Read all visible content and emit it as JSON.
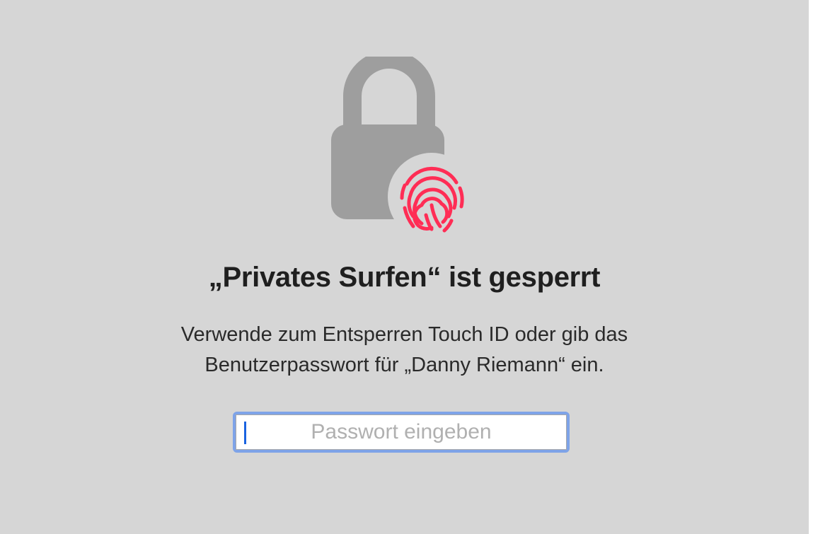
{
  "lock_screen": {
    "title": "„Privates Surfen“ ist gesperrt",
    "description_line1": "Verwende zum Entsperren Touch ID oder gib das",
    "description_line2": "Benutzerpasswort für „Danny Riemann“ ein.",
    "password_field": {
      "value": "",
      "placeholder": "Passwort eingeben"
    },
    "icons": [
      "lock-icon",
      "fingerprint-icon"
    ],
    "colors": {
      "background": "#d6d6d6",
      "lock_gray": "#9e9e9e",
      "fingerprint_red": "#ff2d55",
      "focus_ring": "#7ea3e8",
      "caret": "#1a63e0"
    }
  }
}
